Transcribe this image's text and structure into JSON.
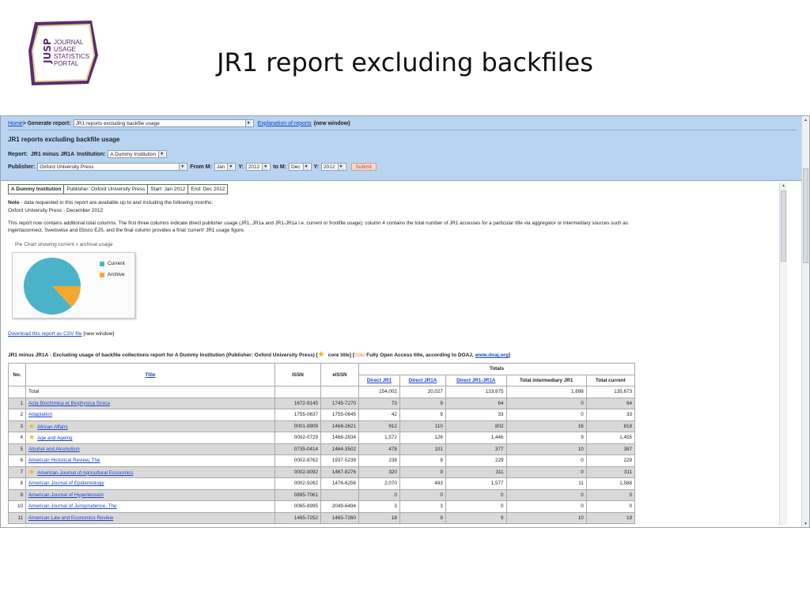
{
  "slide": {
    "title": "JR1 report excluding backfiles",
    "logo": {
      "letters": "JUSP",
      "line1": "JOURNAL",
      "line2": "USAGE",
      "line3": "STATISTICS",
      "line4": "PORTAL"
    }
  },
  "toolbar": {
    "breadcrumb_home": "Home",
    "breadcrumb_sep": " > Generate report:",
    "report_select": "JR1 reports excluding backfile usage",
    "explanation_link": "Explanation of reports",
    "new_window": "(new window)",
    "heading": "JR1 reports excluding backfile usage",
    "report_label": "Report:",
    "report_value": "JR1 minus JR1A",
    "institution_label": "Institution:",
    "institution_select": "A Dummy Institution",
    "publisher_label": "Publisher:",
    "publisher_select": "Oxford University Press",
    "from_m_label": "From M:",
    "from_m": "Jan",
    "from_y_label": "Y:",
    "from_y": "2012",
    "to_m_label": "to M:",
    "to_m": "Dec",
    "to_y_label": "Y:",
    "to_y": "2012",
    "submit": "Submit"
  },
  "infobar": [
    "A Dummy Institution",
    "Publisher: Oxford University Press",
    "Start: Jan 2012",
    "End: Dec 2012"
  ],
  "note": {
    "label": "Note",
    "text": " - data requested in this report are available up to and including the following months:",
    "line2": "Oxford University Press - December 2012",
    "para": "This report now contains additional total columns. The first three columns indicate direct publisher usage (JR1, JR1a and JR1-JR1a i.e. current or frontfile usage); column 4 contains the total number of JR1 accesses for a particular title via aggregator or intermediary sources such as",
    "para2": "ingentaconnect, Swetswise and Ebsco EJS, and the final column provides a final 'current' JR1 usage figure."
  },
  "chart_data": {
    "type": "pie",
    "title": "Pie Chart showing current v archival usage",
    "labels": [
      "Current",
      "Archive"
    ],
    "values": [
      133975,
      20027
    ],
    "colors": [
      "#4bb3c9",
      "#f0a830"
    ]
  },
  "download": {
    "link": "Download this report as CSV file",
    "suffix": " [new window]"
  },
  "report_caption": {
    "main": "JR1 minus JR1A - Excluding usage of backfile collections report for A Dummy Institution (Publisher: Oxford University Press) [",
    "core": " core title] [",
    "doaj_badge": "DOAJ",
    "doaj_text": " Fully Open Access title, according to DOAJ, ",
    "doaj_link": "www.doaj.org",
    "end": "]"
  },
  "table": {
    "headers": {
      "no": "No.",
      "title": "Title",
      "issn": "ISSN",
      "eissn": "eISSN",
      "totals": "Totals",
      "direct_jr1": "Direct JR1",
      "direct_jr1a": "Direct JR1A",
      "direct_jr1_jr1a": "Direct JR1-JR1A",
      "total_intermediary": "Total intermediary JR1",
      "total_current": "Total current"
    },
    "total_row": {
      "label": "Total",
      "jr1": "154,002",
      "jr1a": "20,027",
      "diff": "133,975",
      "inter": "1,698",
      "current": "135,673"
    },
    "rows": [
      {
        "no": "1",
        "title": "Acta Biochimica et Biophysica Sinica",
        "star": false,
        "issn": "1672-9145",
        "eissn": "1745-7270",
        "jr1": "73",
        "jr1a": "9",
        "diff": "64",
        "inter": "0",
        "current": "64"
      },
      {
        "no": "2",
        "title": "Adaptation",
        "star": false,
        "issn": "1755-0637",
        "eissn": "1755-0645",
        "jr1": "42",
        "jr1a": "9",
        "diff": "33",
        "inter": "0",
        "current": "33"
      },
      {
        "no": "3",
        "title": "African Affairs",
        "star": true,
        "issn": "0001-9909",
        "eissn": "1468-2621",
        "jr1": "912",
        "jr1a": "110",
        "diff": "802",
        "inter": "16",
        "current": "818"
      },
      {
        "no": "4",
        "title": "Age and Ageing",
        "star": true,
        "issn": "0002-0729",
        "eissn": "1468-2834",
        "jr1": "1,572",
        "jr1a": "126",
        "diff": "1,446",
        "inter": "9",
        "current": "1,455"
      },
      {
        "no": "5",
        "title": "Alcohol and Alcoholism",
        "star": false,
        "issn": "0735-0414",
        "eissn": "1464-3502",
        "jr1": "478",
        "jr1a": "101",
        "diff": "377",
        "inter": "10",
        "current": "387"
      },
      {
        "no": "6",
        "title": "American Historical Review, The",
        "star": false,
        "issn": "0002-8762",
        "eissn": "1937-5239",
        "jr1": "238",
        "jr1a": "9",
        "diff": "229",
        "inter": "0",
        "current": "229"
      },
      {
        "no": "7",
        "title": "American Journal of Agricultural Economics",
        "star": true,
        "issn": "0002-9092",
        "eissn": "1467-8276",
        "jr1": "320",
        "jr1a": "9",
        "diff": "311",
        "inter": "0",
        "current": "311"
      },
      {
        "no": "8",
        "title": "American Journal of Epidemiology",
        "star": false,
        "issn": "0002-9262",
        "eissn": "1476-6256",
        "jr1": "2,070",
        "jr1a": "493",
        "diff": "1,577",
        "inter": "11",
        "current": "1,588"
      },
      {
        "no": "9",
        "title": "American Journal of Hypertension",
        "star": false,
        "issn": "0895-7061",
        "eissn": "",
        "jr1": "0",
        "jr1a": "0",
        "diff": "0",
        "inter": "0",
        "current": "0"
      },
      {
        "no": "10",
        "title": "American Journal of Jurisprudence, The",
        "star": false,
        "issn": "0065-8995",
        "eissn": "2049-6494",
        "jr1": "3",
        "jr1a": "3",
        "diff": "0",
        "inter": "0",
        "current": "0"
      },
      {
        "no": "11",
        "title": "American Law and Economics Review",
        "star": false,
        "issn": "1465-7252",
        "eissn": "1465-7260",
        "jr1": "18",
        "jr1a": "9",
        "diff": "9",
        "inter": "10",
        "current": "19"
      }
    ]
  }
}
